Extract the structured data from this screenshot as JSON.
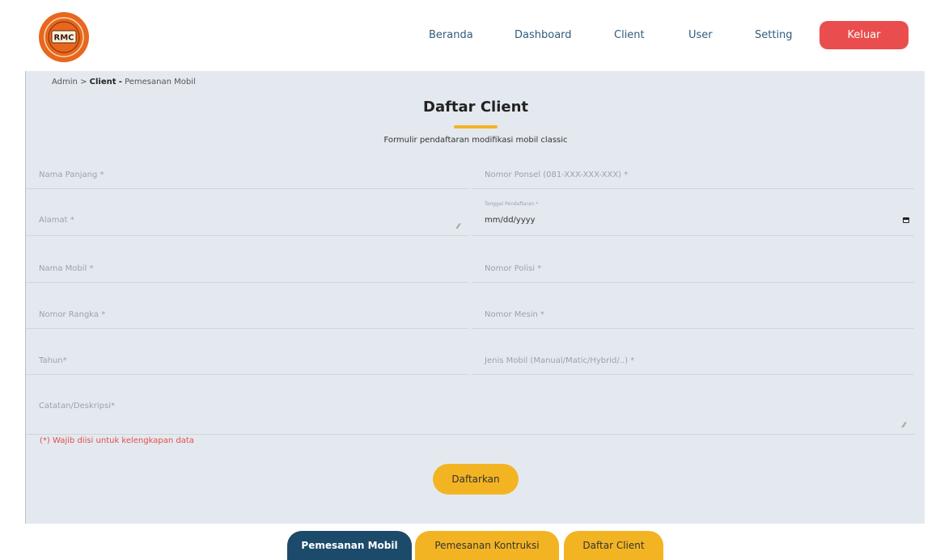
{
  "nav": {
    "items": [
      "Beranda",
      "Dashboard",
      "Client",
      "User",
      "Setting"
    ],
    "logout": "Keluar"
  },
  "logo": {
    "text": "RMC"
  },
  "breadcrumb": {
    "root": "Admin",
    "sep": ">",
    "section": "Client",
    "dash": "-",
    "page": "Pemesanan Mobil"
  },
  "page": {
    "title": "Daftar Client",
    "subtitle": "Formulir pendaftaran modifikasi mobil classic"
  },
  "form": {
    "nama_panjang": "Nama Panjang *",
    "nomor_ponsel": "Nomor Ponsel (081-XXX-XXX-XXX) *",
    "alamat": "Alamat *",
    "tanggal_label": "Tanggal Pendaftaran *",
    "tanggal_value": "mm/dd/yyyy",
    "nama_mobil": "Nama Mobil *",
    "nomor_polisi": "Nomor Polisi *",
    "nomor_rangka": "Nomor Rangka *",
    "nomor_mesin": "Nomor Mesin *",
    "tahun": "Tahun*",
    "jenis_mobil": "Jenis Mobil (Manual/Matic/Hybrid/..) *",
    "catatan": "Catatan/Deskripsi*",
    "note": "(*) Wajib diisi untuk kelengkapan data",
    "submit": "Daftarkan"
  },
  "tabs": [
    "Pemesanan Mobil",
    "Pemesanan Kontruksi",
    "Daftar Client"
  ],
  "colors": {
    "accent": "#f3b423",
    "logout": "#ea4d4d",
    "tab_active": "#1c4a6b",
    "panel": "#e4e9ef",
    "nav_text": "#2f5d7c",
    "warning": "#e44c4c"
  }
}
